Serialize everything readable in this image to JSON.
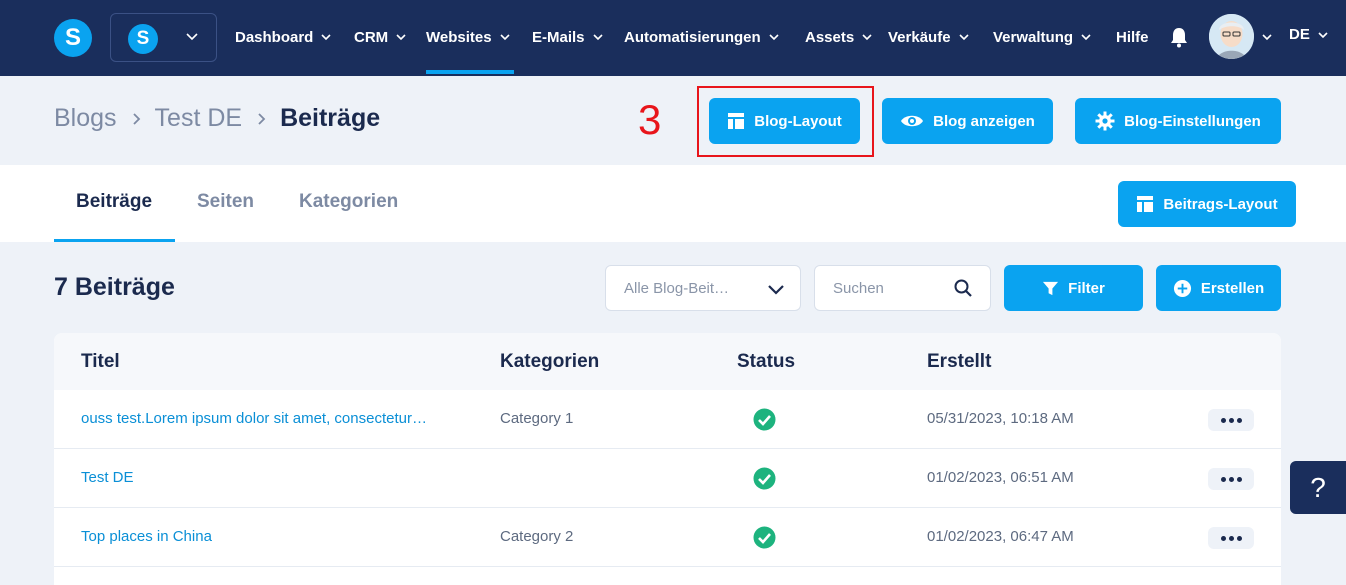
{
  "nav": {
    "logo_letter": "S",
    "workspace_letter": "S",
    "items": [
      {
        "label": "Dashboard",
        "has_caret": true
      },
      {
        "label": "CRM",
        "has_caret": true
      },
      {
        "label": "Websites",
        "has_caret": true,
        "active": true
      },
      {
        "label": "E-Mails",
        "has_caret": true
      },
      {
        "label": "Automatisierungen",
        "has_caret": true
      },
      {
        "label": "Assets",
        "has_caret": true
      },
      {
        "label": "Verkäufe",
        "has_caret": true
      },
      {
        "label": "Verwaltung",
        "has_caret": true
      },
      {
        "label": "Hilfe",
        "has_caret": false
      }
    ],
    "language": "DE"
  },
  "header": {
    "breadcrumb": [
      "Blogs",
      "Test DE",
      "Beiträge"
    ],
    "step_number": "3",
    "buttons": {
      "blog_layout": "Blog-Layout",
      "blog_view": "Blog anzeigen",
      "blog_settings": "Blog-Einstellungen"
    }
  },
  "tabs": {
    "items": [
      "Beiträge",
      "Seiten",
      "Kategorien"
    ],
    "active": "Beiträge",
    "post_layout_button": "Beitrags-Layout"
  },
  "list": {
    "count_title": "7 Beiträge",
    "filter_select_value": "Alle Blog-Beit…",
    "search_placeholder": "Suchen",
    "filter_button": "Filter",
    "create_button": "Erstellen"
  },
  "table": {
    "columns": [
      "Titel",
      "Kategorien",
      "Status",
      "Erstellt"
    ],
    "rows": [
      {
        "title": "ouss test.Lorem ipsum dolor sit amet, consectetur…",
        "category": "Category 1",
        "status": "published",
        "created": "05/31/2023, 10:18 AM"
      },
      {
        "title": "Test DE",
        "category": "",
        "status": "published",
        "created": "01/02/2023, 06:51 AM"
      },
      {
        "title": "Top places in China",
        "category": "Category 2",
        "status": "published",
        "created": "01/02/2023, 06:47 AM"
      }
    ]
  },
  "help": {
    "label": "?"
  },
  "colors": {
    "nav_bg": "#1a2e5c",
    "accent": "#0aa3f0",
    "highlight": "#e8151b",
    "status_ok": "#1db37e",
    "link": "#0a8fd6"
  }
}
